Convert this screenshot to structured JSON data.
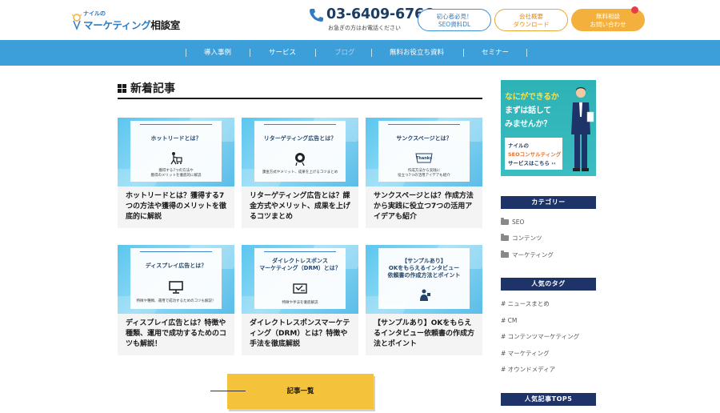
{
  "header": {
    "logo_small": "ナイルの",
    "logo_main_blue": "マーケティング",
    "logo_main_dark": "相談室",
    "phone_number": "03-6409-6766",
    "phone_note": "お急ぎの方はお電話ください",
    "buttons": [
      {
        "line1": "初心者必見！",
        "line2": "SEO資料DL"
      },
      {
        "line1": "会社概要",
        "line2": "ダウンロード"
      },
      {
        "line1": "無料相談",
        "line2": "お問い合わせ"
      }
    ],
    "colors": {
      "nav": "#3d9fd9",
      "accent_orange": "#f3b03c",
      "accent_blue": "#3d8fd6",
      "sidebar_heading": "#1e3368"
    }
  },
  "nav": {
    "items": [
      {
        "label": "導入事例"
      },
      {
        "label": "サービス"
      },
      {
        "label": "ブログ"
      },
      {
        "label": "無料お役立ち資料"
      },
      {
        "label": "セミナー"
      }
    ]
  },
  "main": {
    "section_title": "新着記事",
    "cards": [
      {
        "thumb_title": "ホットリードとは？",
        "thumb_icon": "cart-person-icon",
        "thumb_text_1": "獲得する7つの方法や",
        "thumb_text_2": "獲得のメリットを徹底的に解説",
        "title": "ホットリードとは？獲得する7つの方法や獲得のメリットを徹底的に解説"
      },
      {
        "thumb_title": "リターゲティング広告とは？",
        "thumb_icon": "target-person-icon",
        "thumb_text_1": "課金方式やメリット、成果を上げるコツまとめ",
        "thumb_text_2": "",
        "title": "リターゲティング広告とは？課金方式やメリット、成果を上げるコツまとめ"
      },
      {
        "thumb_title": "サンクスページとは？",
        "thumb_icon": "thanks-card-icon",
        "thumb_text_1": "作成方法から実践に",
        "thumb_text_2": "役立つ7つの活用アイデアも紹介",
        "title": "サンクスページとは？作成方法から実践に役立つ7つの活用アイデアも紹介"
      },
      {
        "thumb_title": "ディスプレイ広告とは？",
        "thumb_icon": "monitor-icon",
        "thumb_text_1": "特徴や種類、運用で成功するためのコツも解説！",
        "thumb_text_2": "",
        "title": "ディスプレイ広告とは？特徴や種類、運用で成功するためのコツも解説！"
      },
      {
        "thumb_title": "ダイレクトレスポンス\nマーケティング（DRM）とは？",
        "thumb_icon": "mail-icon",
        "thumb_text_1": "特徴や手法を徹底解説",
        "thumb_text_2": "",
        "title": "ダイレクトレスポンスマーケティング（DRM）とは？特徴や手法を徹底解説"
      },
      {
        "thumb_title": "【サンプルあり】\nOKをもらえるインタビュー\n依頼書の作成方法とポイント",
        "thumb_icon": "interview-person-icon",
        "thumb_text_1": "",
        "thumb_text_2": "",
        "title": "【サンプルあり】OKをもらえるインタビュー依頼書の作成方法とポイント"
      }
    ],
    "more_button": "記事一覧"
  },
  "sidebar": {
    "banner": {
      "line1": "なにができるか",
      "line2": "まずは話して",
      "line3": "みませんか？",
      "box_line1": "ナイルの",
      "box_line2": "SEOコンサルティング",
      "box_line3": "サービスはこちら ››"
    },
    "category_heading": "カテゴリー",
    "categories": [
      {
        "label": "SEO"
      },
      {
        "label": "コンテンツ"
      },
      {
        "label": "マーケティング"
      }
    ],
    "tags_heading": "人気のタグ",
    "tags": [
      {
        "label": "# ニュースまとめ"
      },
      {
        "label": "# CM"
      },
      {
        "label": "# コンテンツマーケティング"
      },
      {
        "label": "# マーケティング"
      },
      {
        "label": "# オウンドメディア"
      }
    ],
    "ranking_heading": "人気記事TOP5"
  }
}
